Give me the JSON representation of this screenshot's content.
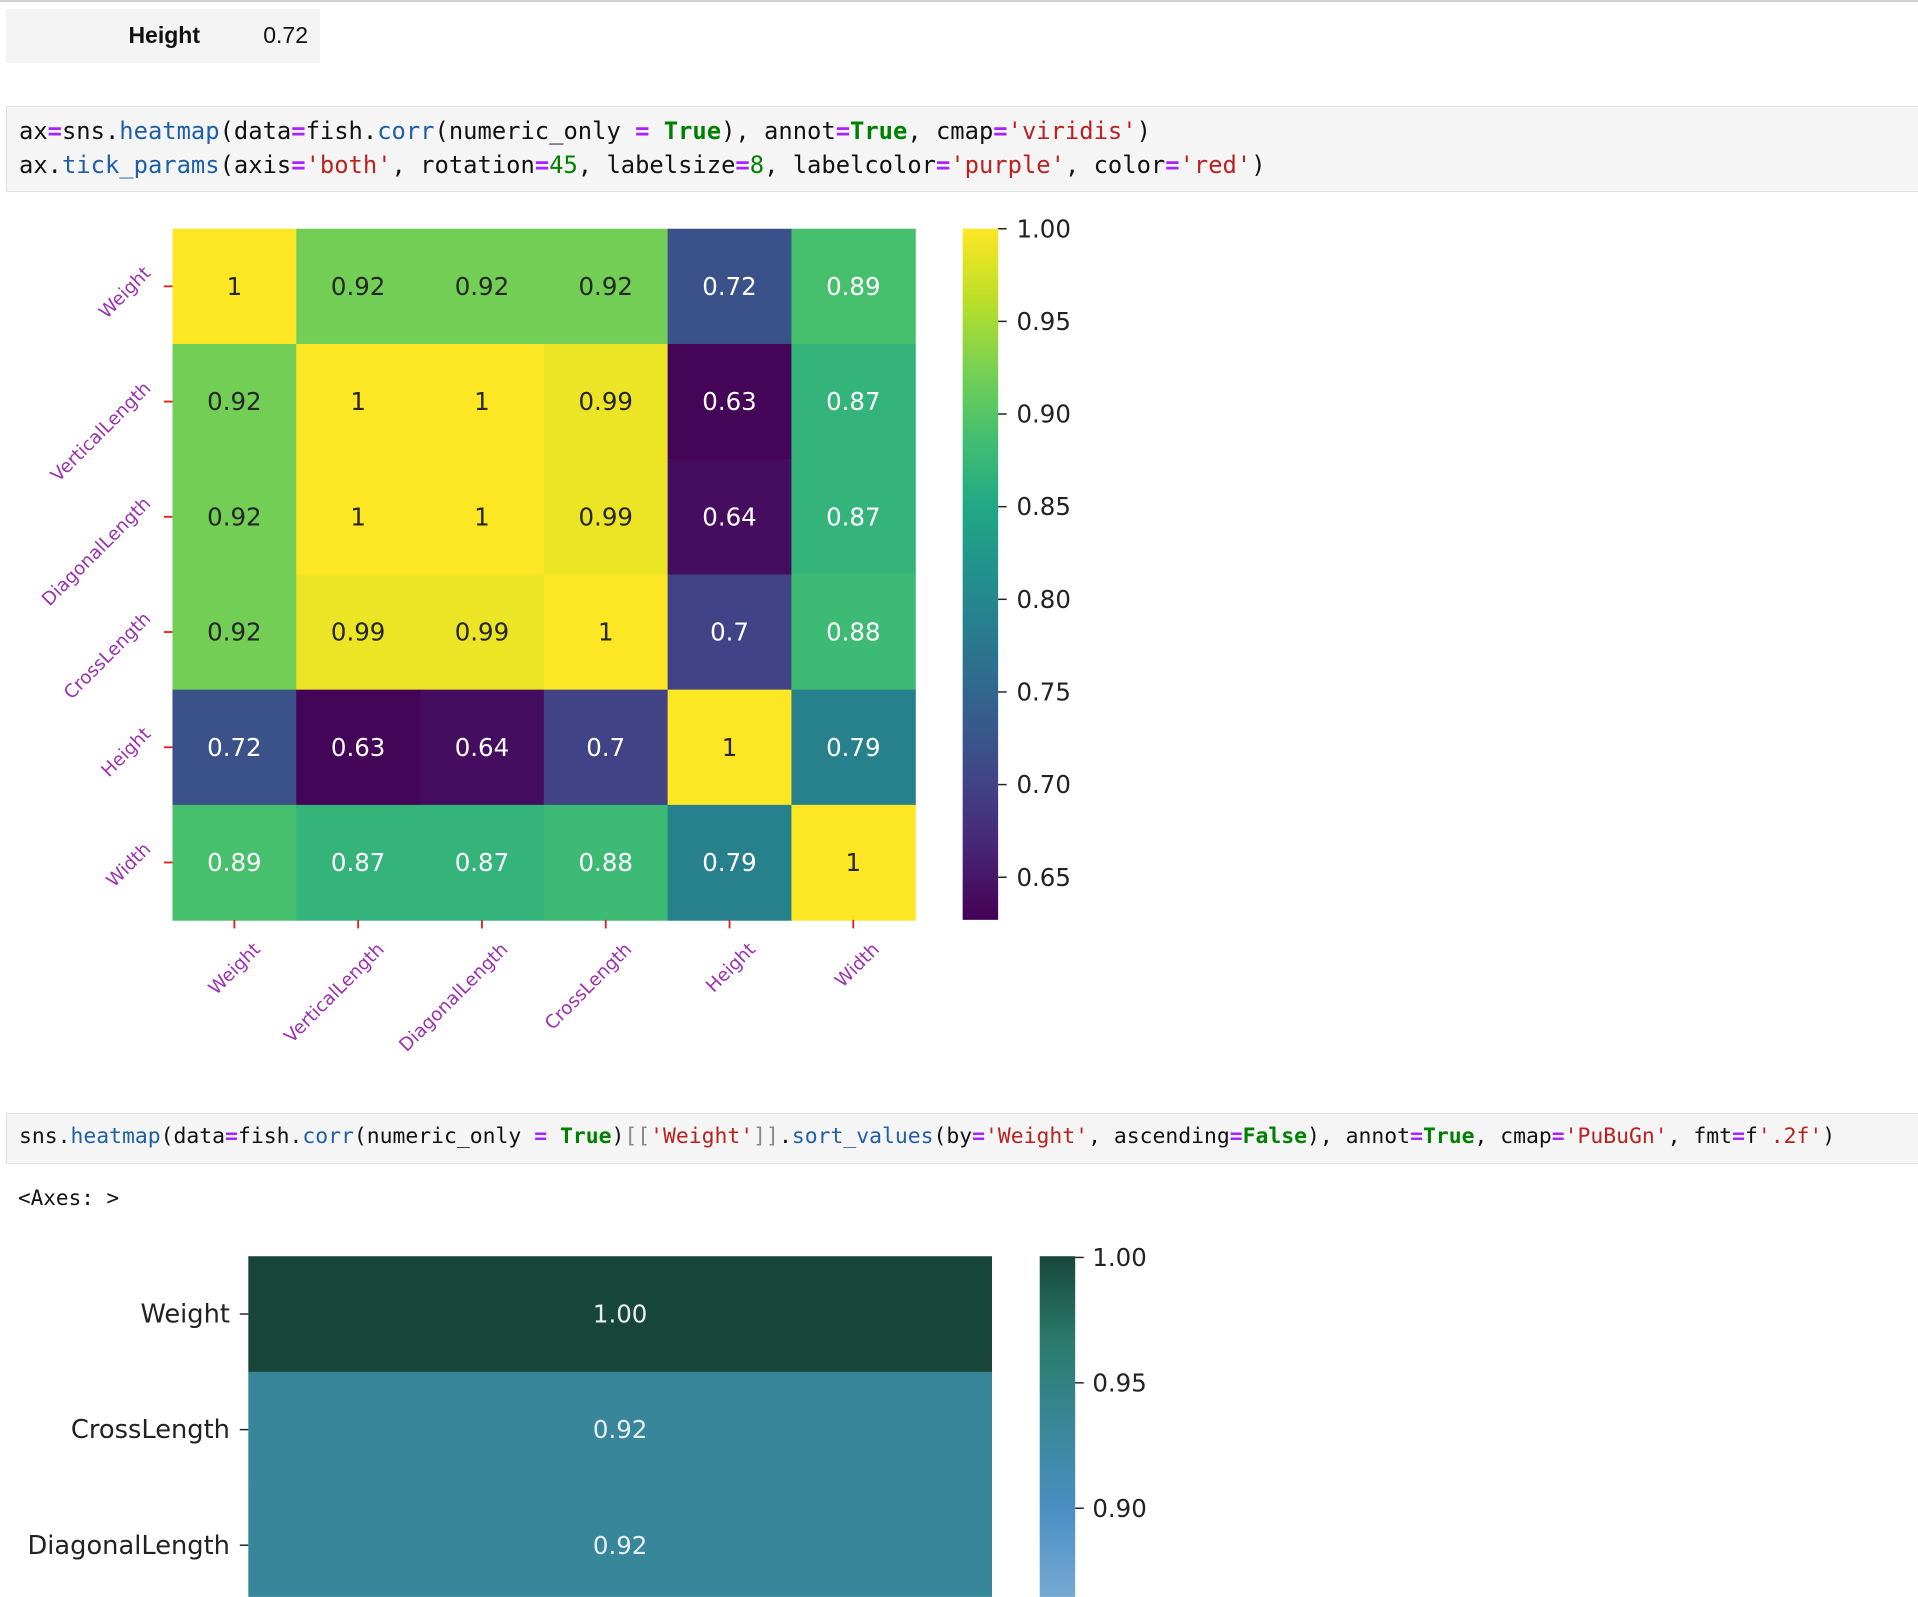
{
  "output_table": {
    "row_label": "Height",
    "value": "0.72"
  },
  "cell1": {
    "lines": [
      [
        [
          "ax",
          "t"
        ],
        [
          "=",
          "o"
        ],
        [
          "sns.",
          "t"
        ],
        [
          "heatmap",
          "f"
        ],
        [
          "(data",
          "t"
        ],
        [
          "=",
          "o"
        ],
        [
          "fish.",
          "t"
        ],
        [
          "corr",
          "f"
        ],
        [
          "(numeric_only ",
          "t"
        ],
        [
          "=",
          "o"
        ],
        [
          " ",
          "t"
        ],
        [
          "True",
          "k"
        ],
        [
          "), annot",
          "t"
        ],
        [
          "=",
          "o"
        ],
        [
          "True",
          "k"
        ],
        [
          ", cmap",
          "t"
        ],
        [
          "=",
          "o"
        ],
        [
          "'viridis'",
          "s"
        ],
        [
          ")",
          "t"
        ]
      ],
      [
        [
          "ax.",
          "t"
        ],
        [
          "tick_params",
          "f"
        ],
        [
          "(axis",
          "t"
        ],
        [
          "=",
          "o"
        ],
        [
          "'both'",
          "s"
        ],
        [
          ", rotation",
          "t"
        ],
        [
          "=",
          "o"
        ],
        [
          "45",
          "n"
        ],
        [
          ", labelsize",
          "t"
        ],
        [
          "=",
          "o"
        ],
        [
          "8",
          "n"
        ],
        [
          ", labelcolor",
          "t"
        ],
        [
          "=",
          "o"
        ],
        [
          "'purple'",
          "s"
        ],
        [
          ", color",
          "t"
        ],
        [
          "=",
          "o"
        ],
        [
          "'red'",
          "s"
        ],
        [
          ")",
          "t"
        ]
      ]
    ]
  },
  "cell2": {
    "lines": [
      [
        [
          "sns.",
          "t"
        ],
        [
          "heatmap",
          "f"
        ],
        [
          "(data",
          "t"
        ],
        [
          "=",
          "o"
        ],
        [
          "fish.",
          "t"
        ],
        [
          "corr",
          "f"
        ],
        [
          "(numeric_only ",
          "t"
        ],
        [
          "=",
          "o"
        ],
        [
          " ",
          "t"
        ],
        [
          "True",
          "k"
        ],
        [
          ")",
          "t"
        ],
        [
          "[[",
          "b"
        ],
        [
          "'Weight'",
          "s"
        ],
        [
          "]]",
          "b"
        ],
        [
          ".",
          "t"
        ],
        [
          "sort_values",
          "f"
        ],
        [
          "(by",
          "t"
        ],
        [
          "=",
          "o"
        ],
        [
          "'Weight'",
          "s"
        ],
        [
          ", ascending",
          "t"
        ],
        [
          "=",
          "o"
        ],
        [
          "False",
          "k"
        ],
        [
          "), annot",
          "t"
        ],
        [
          "=",
          "o"
        ],
        [
          "True",
          "k"
        ],
        [
          ", cmap",
          "t"
        ],
        [
          "=",
          "o"
        ],
        [
          "'PuBuGn'",
          "s"
        ],
        [
          ", fmt",
          "t"
        ],
        [
          "=",
          "o"
        ],
        [
          "f",
          "t"
        ],
        [
          "'.2f'",
          "s"
        ],
        [
          ")",
          "t"
        ]
      ]
    ]
  },
  "cell2_output": "<Axes: >",
  "chart_data": [
    {
      "type": "heatmap",
      "cmap": "viridis",
      "rows": [
        "Weight",
        "VerticalLength",
        "DiagonalLength",
        "CrossLength",
        "Height",
        "Width"
      ],
      "cols": [
        "Weight",
        "VerticalLength",
        "DiagonalLength",
        "CrossLength",
        "Height",
        "Width"
      ],
      "values": [
        [
          1,
          0.92,
          0.92,
          0.92,
          0.72,
          0.89
        ],
        [
          0.92,
          1,
          1,
          0.99,
          0.63,
          0.87
        ],
        [
          0.92,
          1,
          1,
          0.99,
          0.64,
          0.87
        ],
        [
          0.92,
          0.99,
          0.99,
          1,
          0.7,
          0.88
        ],
        [
          0.72,
          0.63,
          0.64,
          0.7,
          1,
          0.79
        ],
        [
          0.89,
          0.87,
          0.87,
          0.88,
          0.79,
          1
        ]
      ],
      "annotations": [
        [
          "1",
          "0.92",
          "0.92",
          "0.92",
          "0.72",
          "0.89"
        ],
        [
          "0.92",
          "1",
          "1",
          "0.99",
          "0.63",
          "0.87"
        ],
        [
          "0.92",
          "1",
          "1",
          "0.99",
          "0.64",
          "0.87"
        ],
        [
          "0.92",
          "0.99",
          "0.99",
          "1",
          "0.7",
          "0.88"
        ],
        [
          "0.72",
          "0.63",
          "0.64",
          "0.7",
          "1",
          "0.79"
        ],
        [
          "0.89",
          "0.87",
          "0.87",
          "0.88",
          "0.79",
          "1"
        ]
      ],
      "vmin": 0.627,
      "vmax": 1.0,
      "colorbar_ticks": [
        "0.65",
        "0.70",
        "0.75",
        "0.80",
        "0.85",
        "0.90",
        "0.95",
        "1.00"
      ],
      "tick_label_color": "#9b30b0",
      "tick_color": "#e02020",
      "cmap_stops": [
        "#440154",
        "#482475",
        "#414487",
        "#355f8d",
        "#2a788e",
        "#21918c",
        "#22a884",
        "#44bf70",
        "#7ad151",
        "#bddf26",
        "#fde725"
      ]
    },
    {
      "type": "heatmap",
      "cmap": "PuBuGn",
      "rows": [
        "Weight",
        "CrossLength",
        "DiagonalLength"
      ],
      "cols": [
        "Weight"
      ],
      "values": [
        [
          1.0
        ],
        [
          0.92
        ],
        [
          0.92
        ]
      ],
      "annotations": [
        [
          "1.00"
        ],
        [
          "0.92"
        ],
        [
          "0.92"
        ]
      ],
      "colorbar_ticks": [
        "0.90",
        "0.95",
        "1.00"
      ],
      "cell_colors": [
        "#18473a",
        "#38869a",
        "#38869a"
      ],
      "colorbar_stops": [
        "#18473a",
        "#2a7b6b",
        "#3a8799",
        "#4b8fc4",
        "#76a9d2"
      ]
    }
  ]
}
